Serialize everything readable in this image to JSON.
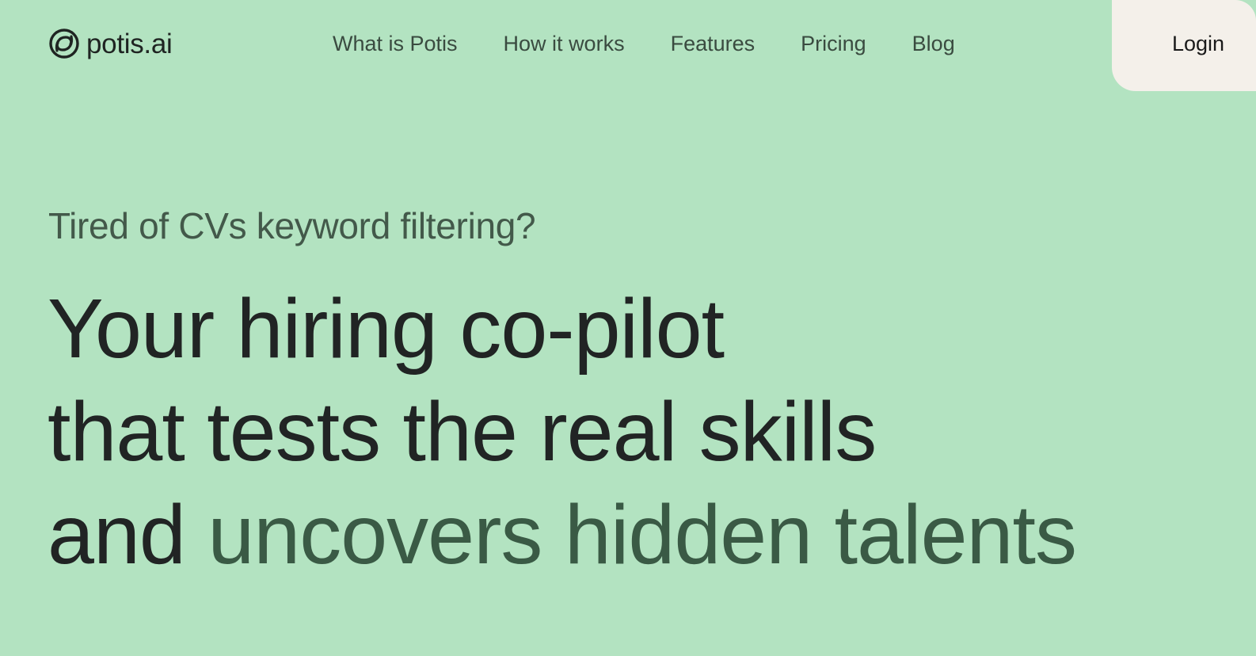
{
  "brand": {
    "name": "potis.ai",
    "icon": "swirl-circle-logo-icon"
  },
  "nav": {
    "items": [
      {
        "label": "What is Potis"
      },
      {
        "label": "How it works"
      },
      {
        "label": "Features"
      },
      {
        "label": "Pricing"
      },
      {
        "label": "Blog"
      }
    ],
    "login_label": "Login"
  },
  "hero": {
    "eyebrow": "Tired of CVs keyword filtering?",
    "line1": "Your hiring co-pilot",
    "line2": "that tests the real skills",
    "line3_prefix": "and ",
    "line3_accent": "uncovers hidden talents"
  },
  "colors": {
    "background": "#b3e3c1",
    "login_tab": "#f4f0ea",
    "headline": "#212424",
    "accent": "#3a5a45",
    "nav_text": "#3a4b40"
  }
}
